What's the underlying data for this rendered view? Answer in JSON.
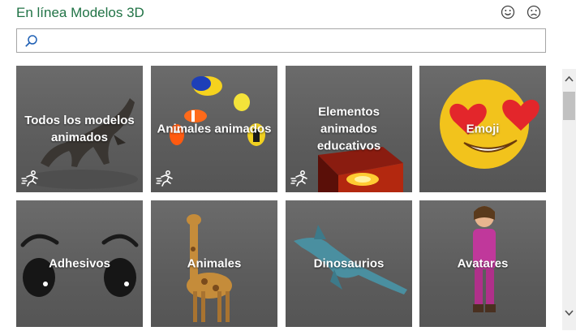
{
  "header": {
    "title": "En línea Modelos 3D"
  },
  "search": {
    "placeholder": "",
    "value": ""
  },
  "tiles": [
    {
      "label": "Todos los modelos animados",
      "animated": true
    },
    {
      "label": "Animales animados",
      "animated": true
    },
    {
      "label": "Elementos animados educativos",
      "animated": true
    },
    {
      "label": "Emoji",
      "animated": false
    },
    {
      "label": "Adhesivos",
      "animated": false
    },
    {
      "label": "Animales",
      "animated": false
    },
    {
      "label": "Dinosaurios",
      "animated": false
    },
    {
      "label": "Avatares",
      "animated": false
    }
  ],
  "colors": {
    "accent": "#217346",
    "tile_bg": "#5e5e5e"
  }
}
